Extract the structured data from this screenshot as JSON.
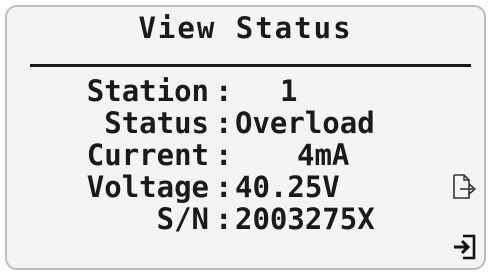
{
  "screen": {
    "title": "View Status",
    "fields": [
      {
        "label": "Station",
        "colon": ":",
        "value": "1"
      },
      {
        "label": "Status",
        "colon": ":",
        "value": "Overload"
      },
      {
        "label": "Current",
        "colon": ":",
        "value": "4mA"
      },
      {
        "label": "Voltage",
        "colon": ":",
        "value": "40.25V"
      },
      {
        "label": "S/N",
        "colon": ":",
        "value": "2003275X"
      }
    ]
  },
  "icons": {
    "export": "export-document-icon",
    "exit": "exit-icon"
  },
  "colors": {
    "text": "#1a1a1a",
    "background": "#f4f4f4",
    "border": "#bdbdbd"
  }
}
